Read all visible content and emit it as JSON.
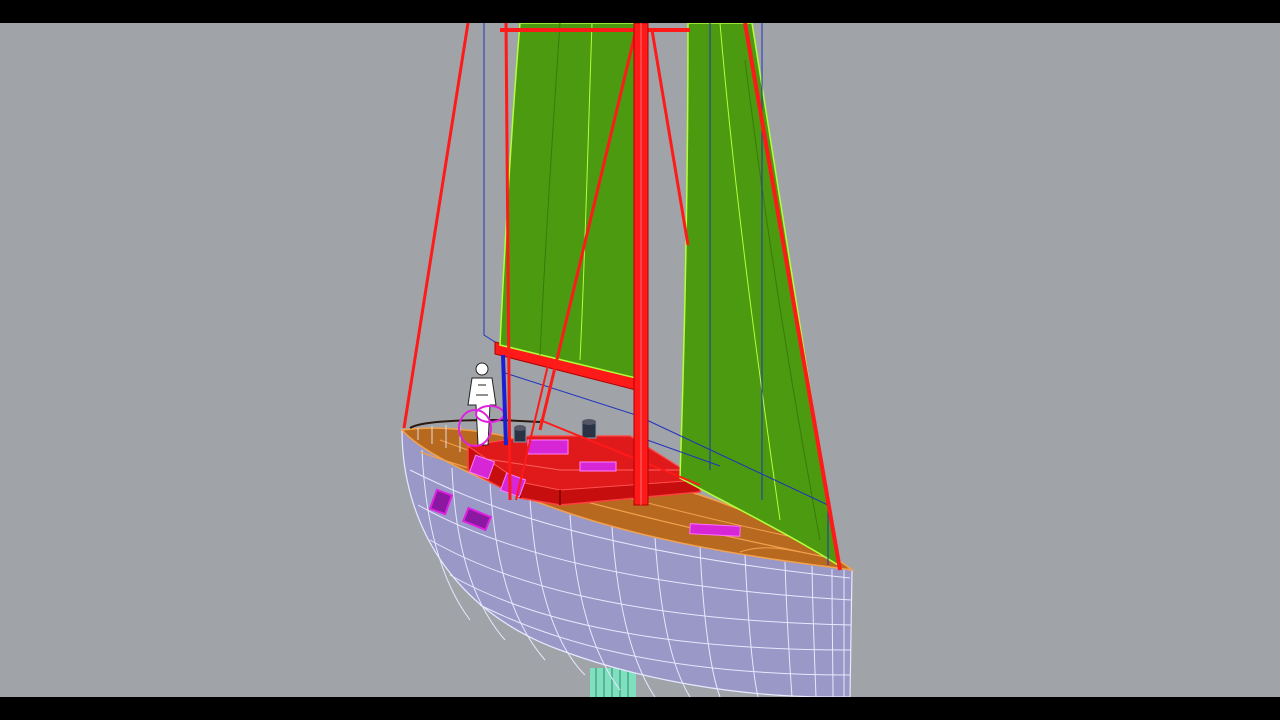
{
  "viewport": {
    "background_color": "#a0a4a9",
    "letterbox_color": "#000000",
    "model": {
      "hull_color": "#9a98c6",
      "hull_grid_color": "#e8e8ff",
      "deck_color": "#b76a1f",
      "deck_line_color": "#f2a04c",
      "cabin_color": "#d91616",
      "rigging_color": "#ff1a1a",
      "sail_color": "#4c9a10",
      "sail_edge_color": "#b4ff3a",
      "highlight_color": "#e020e0",
      "construction_line_color": "#2233bb",
      "keel_color": "#7fe0c0",
      "figure_color": "#ffffff"
    }
  }
}
